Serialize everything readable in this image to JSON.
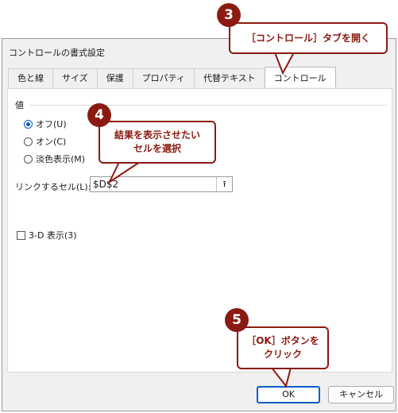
{
  "dialog": {
    "title": "コントロールの書式設定",
    "tabs": [
      "色と線",
      "サイズ",
      "保護",
      "プロパティ",
      "代替テキスト",
      "コントロール"
    ],
    "active_tab": "コントロール"
  },
  "control": {
    "group_label": "値",
    "radios": [
      {
        "label": "オフ(U)",
        "selected": true
      },
      {
        "label": "オン(C)",
        "selected": false
      },
      {
        "label": "淡色表示(M)",
        "selected": false
      }
    ],
    "link_label": "リンクするセル(L):",
    "link_value": "$D$2",
    "checkbox_label": "3-D 表示(3)",
    "checkbox_checked": false
  },
  "buttons": {
    "ok": "OK",
    "cancel": "キャンセル"
  },
  "callouts": {
    "c3": {
      "num": "3",
      "text": "［コントロール］タブを開く"
    },
    "c4": {
      "num": "4",
      "line1": "結果を表示させたい",
      "line2": "セルを選択"
    },
    "c5": {
      "num": "5",
      "line1": "［OK］ボタンを",
      "line2": "クリック"
    }
  },
  "colors": {
    "callout": "#8b1a12",
    "accent": "#0a5fc4"
  }
}
